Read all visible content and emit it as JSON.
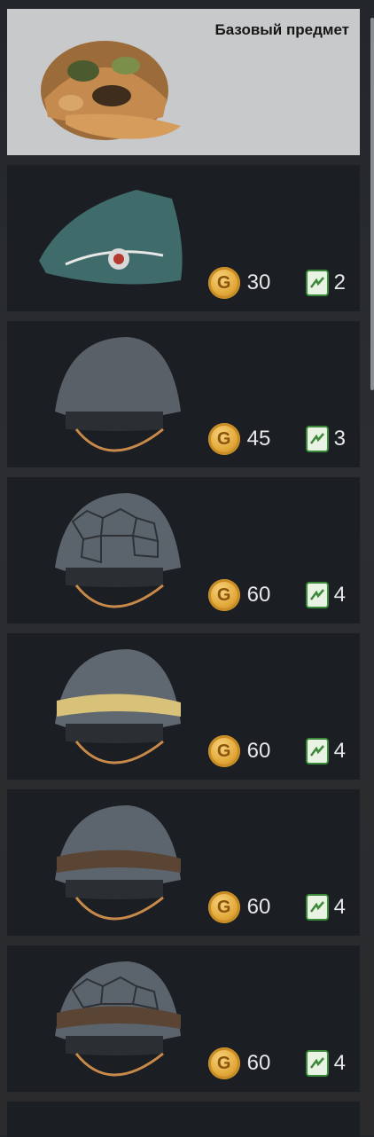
{
  "base": {
    "label": "Базовый предмет"
  },
  "items": [
    {
      "coins": "30",
      "tickets": "2"
    },
    {
      "coins": "45",
      "tickets": "3"
    },
    {
      "coins": "60",
      "tickets": "4"
    },
    {
      "coins": "60",
      "tickets": "4"
    },
    {
      "coins": "60",
      "tickets": "4"
    },
    {
      "coins": "60",
      "tickets": "4"
    }
  ],
  "icons": {
    "coin_letter": "G"
  },
  "colors": {
    "base_bg": "#c8c9ca",
    "card_bg": "#1b1e22",
    "coin": "#e3a93a",
    "ticket": "#3b8a3a"
  }
}
